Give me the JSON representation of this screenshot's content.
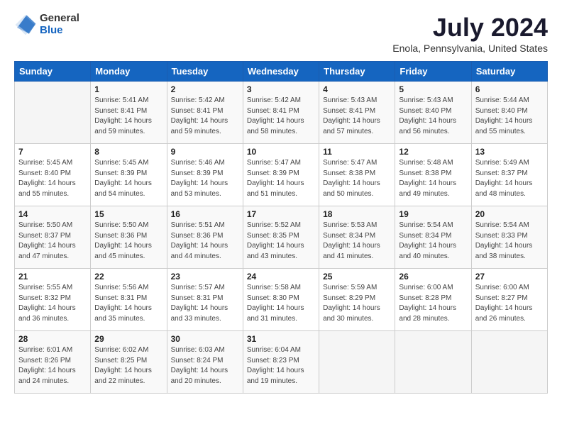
{
  "logo": {
    "general": "General",
    "blue": "Blue"
  },
  "title": {
    "month_year": "July 2024",
    "location": "Enola, Pennsylvania, United States"
  },
  "days_of_week": [
    "Sunday",
    "Monday",
    "Tuesday",
    "Wednesday",
    "Thursday",
    "Friday",
    "Saturday"
  ],
  "weeks": [
    [
      {
        "day": "",
        "detail": ""
      },
      {
        "day": "1",
        "detail": "Sunrise: 5:41 AM\nSunset: 8:41 PM\nDaylight: 14 hours\nand 59 minutes."
      },
      {
        "day": "2",
        "detail": "Sunrise: 5:42 AM\nSunset: 8:41 PM\nDaylight: 14 hours\nand 59 minutes."
      },
      {
        "day": "3",
        "detail": "Sunrise: 5:42 AM\nSunset: 8:41 PM\nDaylight: 14 hours\nand 58 minutes."
      },
      {
        "day": "4",
        "detail": "Sunrise: 5:43 AM\nSunset: 8:41 PM\nDaylight: 14 hours\nand 57 minutes."
      },
      {
        "day": "5",
        "detail": "Sunrise: 5:43 AM\nSunset: 8:40 PM\nDaylight: 14 hours\nand 56 minutes."
      },
      {
        "day": "6",
        "detail": "Sunrise: 5:44 AM\nSunset: 8:40 PM\nDaylight: 14 hours\nand 55 minutes."
      }
    ],
    [
      {
        "day": "7",
        "detail": "Sunrise: 5:45 AM\nSunset: 8:40 PM\nDaylight: 14 hours\nand 55 minutes."
      },
      {
        "day": "8",
        "detail": "Sunrise: 5:45 AM\nSunset: 8:39 PM\nDaylight: 14 hours\nand 54 minutes."
      },
      {
        "day": "9",
        "detail": "Sunrise: 5:46 AM\nSunset: 8:39 PM\nDaylight: 14 hours\nand 53 minutes."
      },
      {
        "day": "10",
        "detail": "Sunrise: 5:47 AM\nSunset: 8:39 PM\nDaylight: 14 hours\nand 51 minutes."
      },
      {
        "day": "11",
        "detail": "Sunrise: 5:47 AM\nSunset: 8:38 PM\nDaylight: 14 hours\nand 50 minutes."
      },
      {
        "day": "12",
        "detail": "Sunrise: 5:48 AM\nSunset: 8:38 PM\nDaylight: 14 hours\nand 49 minutes."
      },
      {
        "day": "13",
        "detail": "Sunrise: 5:49 AM\nSunset: 8:37 PM\nDaylight: 14 hours\nand 48 minutes."
      }
    ],
    [
      {
        "day": "14",
        "detail": "Sunrise: 5:50 AM\nSunset: 8:37 PM\nDaylight: 14 hours\nand 47 minutes."
      },
      {
        "day": "15",
        "detail": "Sunrise: 5:50 AM\nSunset: 8:36 PM\nDaylight: 14 hours\nand 45 minutes."
      },
      {
        "day": "16",
        "detail": "Sunrise: 5:51 AM\nSunset: 8:36 PM\nDaylight: 14 hours\nand 44 minutes."
      },
      {
        "day": "17",
        "detail": "Sunrise: 5:52 AM\nSunset: 8:35 PM\nDaylight: 14 hours\nand 43 minutes."
      },
      {
        "day": "18",
        "detail": "Sunrise: 5:53 AM\nSunset: 8:34 PM\nDaylight: 14 hours\nand 41 minutes."
      },
      {
        "day": "19",
        "detail": "Sunrise: 5:54 AM\nSunset: 8:34 PM\nDaylight: 14 hours\nand 40 minutes."
      },
      {
        "day": "20",
        "detail": "Sunrise: 5:54 AM\nSunset: 8:33 PM\nDaylight: 14 hours\nand 38 minutes."
      }
    ],
    [
      {
        "day": "21",
        "detail": "Sunrise: 5:55 AM\nSunset: 8:32 PM\nDaylight: 14 hours\nand 36 minutes."
      },
      {
        "day": "22",
        "detail": "Sunrise: 5:56 AM\nSunset: 8:31 PM\nDaylight: 14 hours\nand 35 minutes."
      },
      {
        "day": "23",
        "detail": "Sunrise: 5:57 AM\nSunset: 8:31 PM\nDaylight: 14 hours\nand 33 minutes."
      },
      {
        "day": "24",
        "detail": "Sunrise: 5:58 AM\nSunset: 8:30 PM\nDaylight: 14 hours\nand 31 minutes."
      },
      {
        "day": "25",
        "detail": "Sunrise: 5:59 AM\nSunset: 8:29 PM\nDaylight: 14 hours\nand 30 minutes."
      },
      {
        "day": "26",
        "detail": "Sunrise: 6:00 AM\nSunset: 8:28 PM\nDaylight: 14 hours\nand 28 minutes."
      },
      {
        "day": "27",
        "detail": "Sunrise: 6:00 AM\nSunset: 8:27 PM\nDaylight: 14 hours\nand 26 minutes."
      }
    ],
    [
      {
        "day": "28",
        "detail": "Sunrise: 6:01 AM\nSunset: 8:26 PM\nDaylight: 14 hours\nand 24 minutes."
      },
      {
        "day": "29",
        "detail": "Sunrise: 6:02 AM\nSunset: 8:25 PM\nDaylight: 14 hours\nand 22 minutes."
      },
      {
        "day": "30",
        "detail": "Sunrise: 6:03 AM\nSunset: 8:24 PM\nDaylight: 14 hours\nand 20 minutes."
      },
      {
        "day": "31",
        "detail": "Sunrise: 6:04 AM\nSunset: 8:23 PM\nDaylight: 14 hours\nand 19 minutes."
      },
      {
        "day": "",
        "detail": ""
      },
      {
        "day": "",
        "detail": ""
      },
      {
        "day": "",
        "detail": ""
      }
    ]
  ]
}
